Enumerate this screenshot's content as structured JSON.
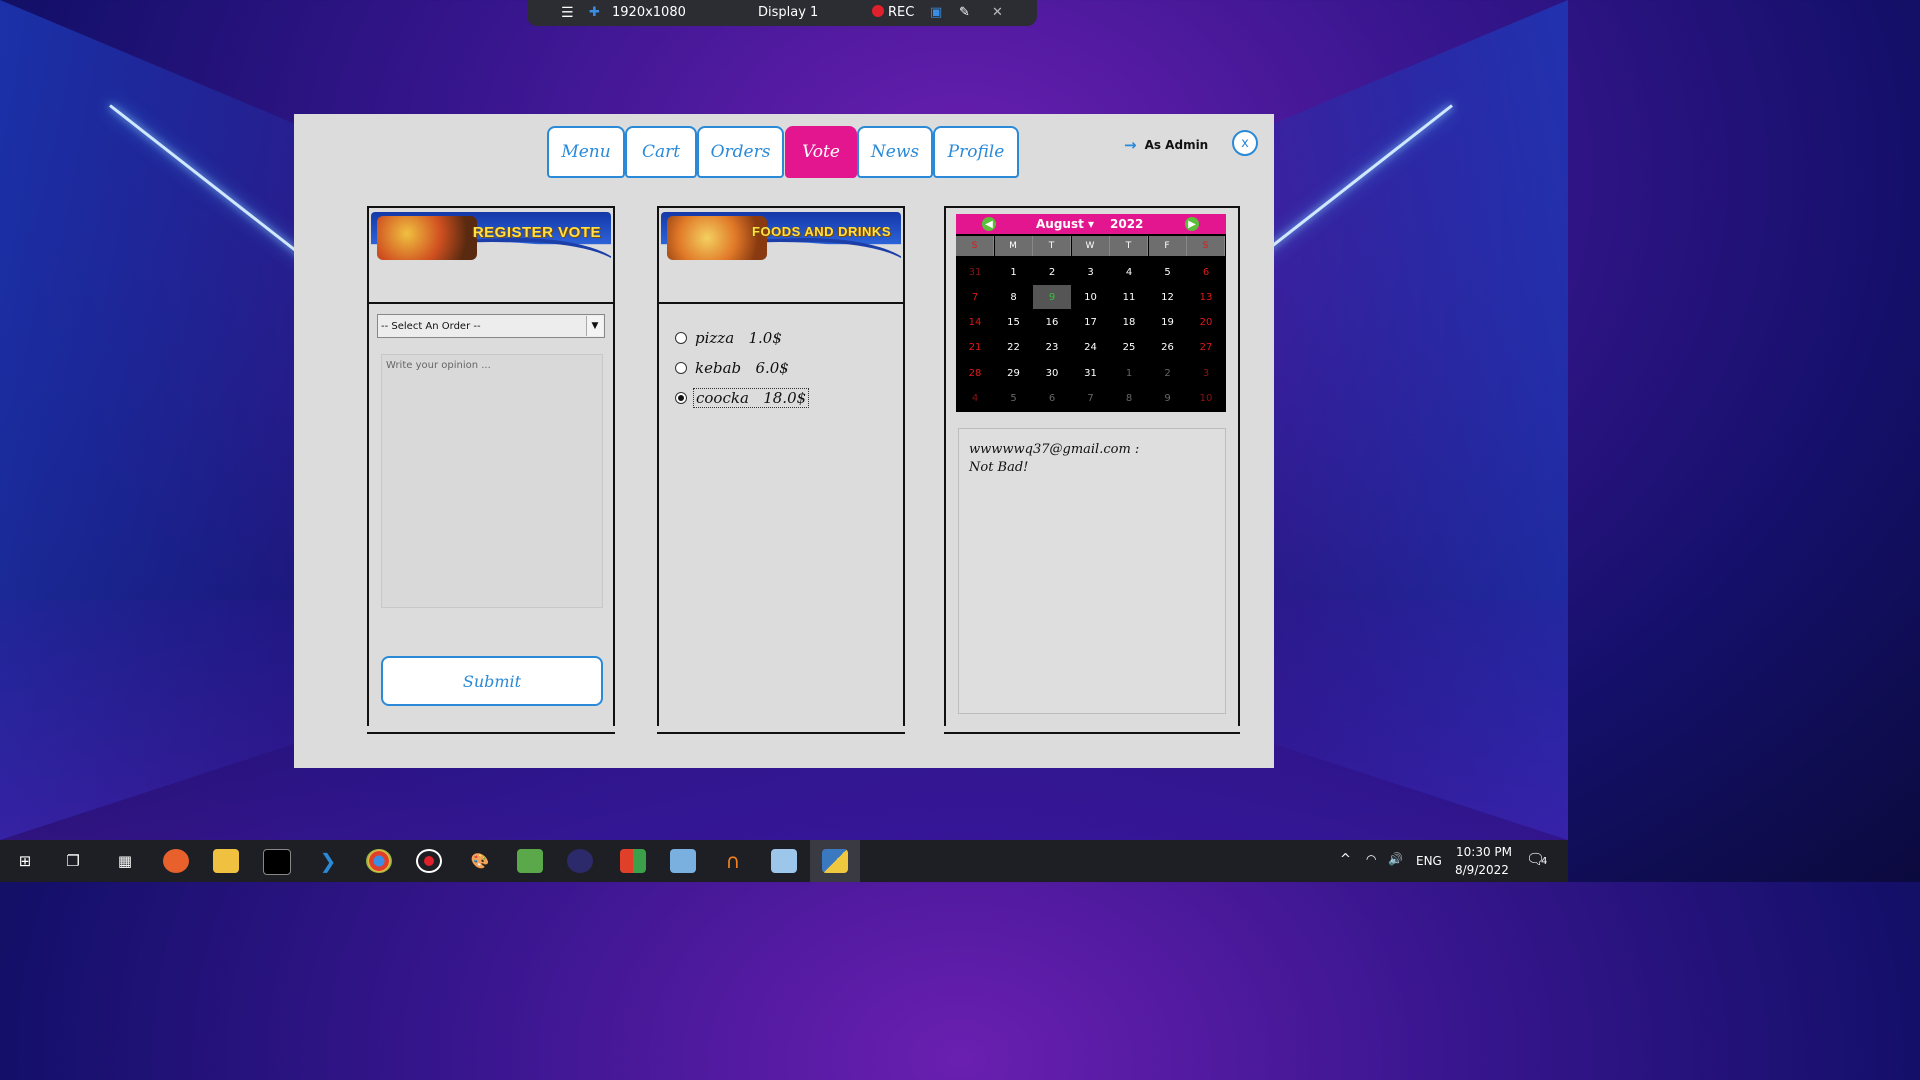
{
  "recorder": {
    "resolution": "1920x1080",
    "display": "Display 1",
    "rec": "REC"
  },
  "tabs": [
    {
      "label": "Menu",
      "active": false
    },
    {
      "label": "Cart",
      "active": false
    },
    {
      "label": "Orders",
      "active": false
    },
    {
      "label": "Vote",
      "active": true
    },
    {
      "label": "News",
      "active": false
    },
    {
      "label": "Profile",
      "active": false
    }
  ],
  "header": {
    "admin_label": "As Admin",
    "close_label": "x"
  },
  "vote_panel": {
    "banner_title": "REGISTER VOTE",
    "select_value": "-- Select An Order --",
    "opinion_placeholder": "Write your opinion ...",
    "submit_label": "Submit"
  },
  "foods_panel": {
    "banner_title": "FOODS AND DRINKS",
    "items": [
      {
        "name": "pizza",
        "price": "1.0$",
        "selected": false
      },
      {
        "name": "kebab",
        "price": "6.0$",
        "selected": false
      },
      {
        "name": "coocka",
        "price": "18.0$",
        "selected": true
      }
    ]
  },
  "calendar": {
    "month": "August",
    "year": "2022",
    "weekdays": [
      "S",
      "M",
      "T",
      "W",
      "T",
      "F",
      "S"
    ],
    "weeks": [
      [
        "31",
        "1",
        "2",
        "3",
        "4",
        "5",
        "6"
      ],
      [
        "7",
        "8",
        "9",
        "10",
        "11",
        "12",
        "13"
      ],
      [
        "14",
        "15",
        "16",
        "17",
        "18",
        "19",
        "20"
      ],
      [
        "21",
        "22",
        "23",
        "24",
        "25",
        "26",
        "27"
      ],
      [
        "28",
        "29",
        "30",
        "31",
        "1",
        "2",
        "3"
      ],
      [
        "4",
        "5",
        "6",
        "7",
        "8",
        "9",
        "10"
      ]
    ],
    "today": "9"
  },
  "comments": {
    "author": "wwwwwq37@gmail.com :",
    "text": "Not Bad!"
  },
  "taskbar": {
    "language": "ENG",
    "time": "10:30 PM",
    "date": "8/9/2022",
    "notifications": "4"
  },
  "colors": {
    "accent": "#2a8ad8",
    "active_tab": "#e4168f",
    "panel_bg": "#dcdcdc"
  }
}
